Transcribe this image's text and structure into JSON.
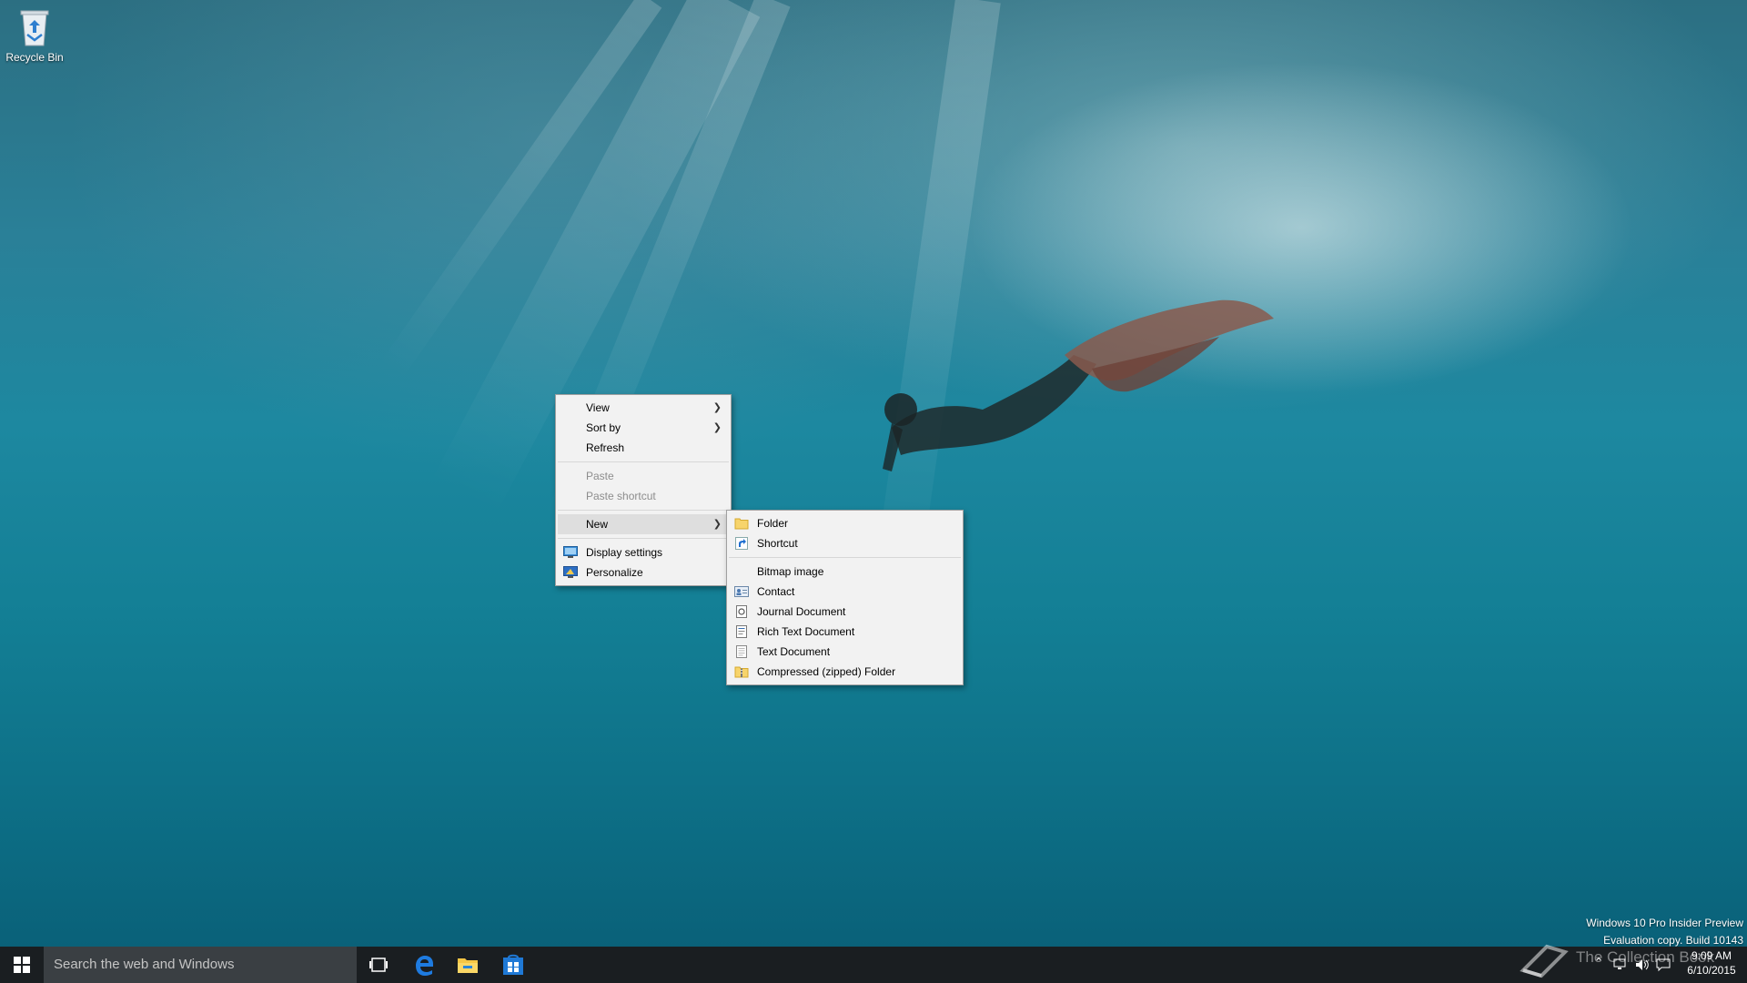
{
  "desktop": {
    "icons": [
      {
        "label": "Recycle Bin",
        "icon": "recycle-bin-icon"
      }
    ],
    "watermark": {
      "line1": "Windows 10 Pro Insider Preview",
      "line2": "Evaluation copy. Build 10143"
    }
  },
  "context_menu": {
    "view": "View",
    "sort_by": "Sort by",
    "refresh": "Refresh",
    "paste": "Paste",
    "paste_shortcut": "Paste shortcut",
    "new": "New",
    "display_settings": "Display settings",
    "personalize": "Personalize"
  },
  "new_submenu": {
    "folder": "Folder",
    "shortcut": "Shortcut",
    "bitmap": "Bitmap image",
    "contact": "Contact",
    "journal": "Journal Document",
    "rich_text": "Rich Text Document",
    "text": "Text Document",
    "compressed": "Compressed (zipped) Folder"
  },
  "taskbar": {
    "search_placeholder": "Search the web and Windows",
    "clock_time": "9:09 AM",
    "clock_date": "6/10/2015",
    "watermark_brand": "The Collection Book"
  },
  "colors": {
    "taskbar_bg": "#1a1e21",
    "search_bg": "#3a3f43",
    "accent_blue": "#0078d7",
    "menu_bg": "#f2f2f2"
  }
}
